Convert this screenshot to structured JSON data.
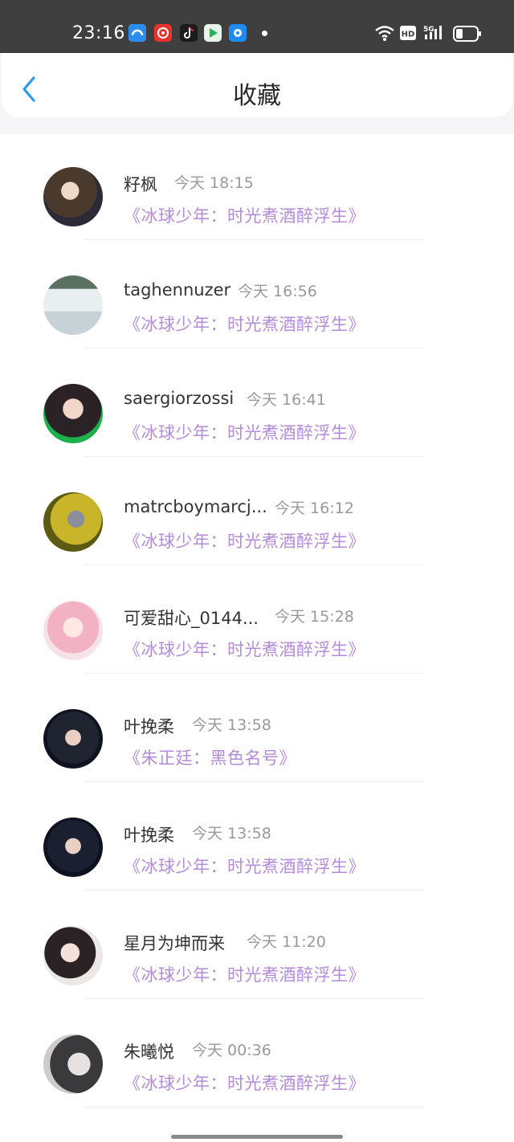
{
  "status_bar": {
    "time": "23:16",
    "apps": [
      {
        "icon": "cloud-app-icon",
        "color": "#2a8cf0"
      },
      {
        "icon": "netease-music-icon",
        "color": "#e8322e"
      },
      {
        "icon": "tiktok-icon",
        "color": "#1c1c1c"
      },
      {
        "icon": "video-app-icon",
        "color": "#23b45a"
      },
      {
        "icon": "browser-app-icon",
        "color": "#1f8cf2"
      }
    ],
    "network": "5G",
    "hd_label": "HD"
  },
  "header": {
    "title": "收藏"
  },
  "items": [
    {
      "name": "籽枫",
      "time": "今天 18:15",
      "work": "《冰球少年：时光煮酒醉浮生》",
      "avatar_color": "#4a3a2e"
    },
    {
      "name": "taghennuzer",
      "time": "今天 16:56",
      "work": "《冰球少年：时光煮酒醉浮生》",
      "avatar_color": "#cfd6d8"
    },
    {
      "name": "saergiorzossi",
      "time": "今天 16:41",
      "work": "《冰球少年：时光煮酒醉浮生》",
      "avatar_color": "#e8b7a6"
    },
    {
      "name": "matrcboymarcj...",
      "time": "今天 16:12",
      "work": "《冰球少年：时光煮酒醉浮生》",
      "avatar_color": "#a39a1a"
    },
    {
      "name": "可爱甜心_0144...",
      "time": "今天 15:28",
      "work": "《冰球少年：时光煮酒醉浮生》",
      "avatar_color": "#f2c4cf"
    },
    {
      "name": "叶挽柔",
      "time": "今天 13:58",
      "work": "《朱正廷：黑色名号》",
      "avatar_color": "#1f2430"
    },
    {
      "name": "叶挽柔",
      "time": "今天 13:58",
      "work": "《冰球少年：时光煮酒醉浮生》",
      "avatar_color": "#1b2030"
    },
    {
      "name": "星月为坤而来",
      "time": "今天 11:20",
      "work": "《冰球少年：时光煮酒醉浮生》",
      "avatar_color": "#6b5a58"
    },
    {
      "name": "朱曦悦",
      "time": "今天 00:36",
      "work": "《冰球少年：时光煮酒醉浮生》",
      "avatar_color": "#3a3a3c"
    }
  ]
}
